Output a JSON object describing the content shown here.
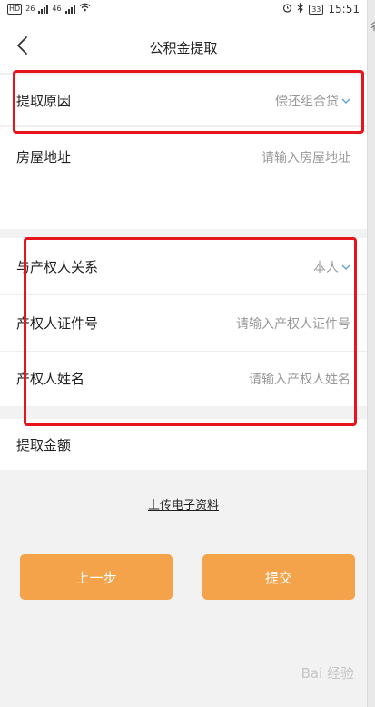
{
  "status_bar": {
    "hd": "HD",
    "sig1": "26",
    "sig2": "46",
    "battery": "33",
    "time": "15:51"
  },
  "nav": {
    "title": "公积金提取"
  },
  "form": {
    "reason_label": "提取原因",
    "reason_value": "偿还组合贷",
    "address_label": "房屋地址",
    "address_placeholder": "请输入房屋地址",
    "relation_label": "与产权人关系",
    "relation_value": "本人",
    "owner_id_label": "产权人证件号",
    "owner_id_placeholder": "请输入产权人证件号",
    "owner_name_label": "产权人姓名",
    "owner_name_placeholder": "请输入产权人姓名",
    "amount_label": "提取金额"
  },
  "upload_link": "上传电子资料",
  "buttons": {
    "prev": "上一步",
    "submit": "提交"
  },
  "side_glyph": "彳",
  "watermark": "Bai 经验",
  "colors": {
    "accent_orange": "#f5a34a",
    "highlight_red": "#e8141b",
    "chevron_blue": "#5b9bd5"
  }
}
